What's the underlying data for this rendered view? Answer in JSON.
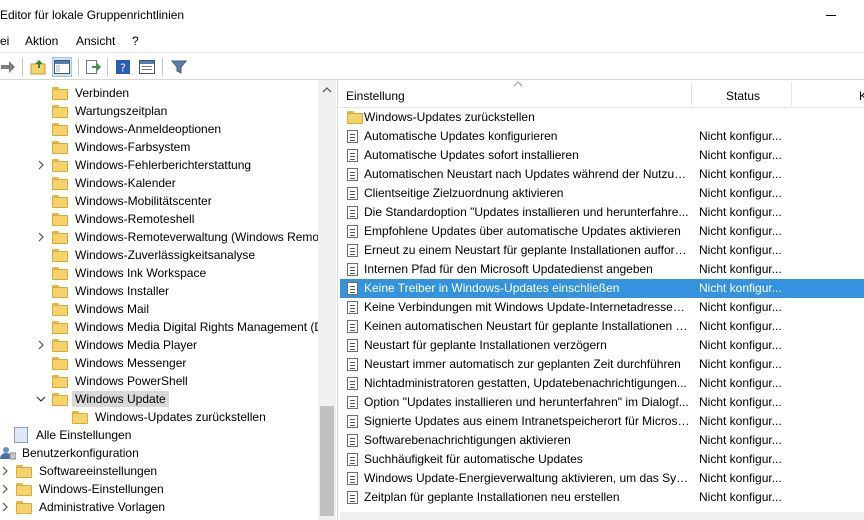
{
  "window": {
    "title": "Editor für lokale Gruppenrichtlinien"
  },
  "menu": [
    "ei",
    "Aktion",
    "Ansicht",
    "?"
  ],
  "tree": [
    {
      "label": "Verbinden",
      "indent": 2,
      "expandable": false
    },
    {
      "label": "Wartungszeitplan",
      "indent": 2,
      "expandable": false
    },
    {
      "label": "Windows-Anmeldeoptionen",
      "indent": 2,
      "expandable": false
    },
    {
      "label": "Windows-Farbsystem",
      "indent": 2,
      "expandable": false
    },
    {
      "label": "Windows-Fehlerberichterstattung",
      "indent": 2,
      "expandable": true
    },
    {
      "label": "Windows-Kalender",
      "indent": 2,
      "expandable": false
    },
    {
      "label": "Windows-Mobilitätscenter",
      "indent": 2,
      "expandable": false
    },
    {
      "label": "Windows-Remoteshell",
      "indent": 2,
      "expandable": false
    },
    {
      "label": "Windows-Remoteverwaltung (Windows Remo",
      "indent": 2,
      "expandable": true
    },
    {
      "label": "Windows-Zuverlässigkeitsanalyse",
      "indent": 2,
      "expandable": false
    },
    {
      "label": "Windows Ink Workspace",
      "indent": 2,
      "expandable": false
    },
    {
      "label": "Windows Installer",
      "indent": 2,
      "expandable": false
    },
    {
      "label": "Windows Mail",
      "indent": 2,
      "expandable": false
    },
    {
      "label": "Windows Media Digital Rights Management (D",
      "indent": 2,
      "expandable": false
    },
    {
      "label": "Windows Media Player",
      "indent": 2,
      "expandable": true
    },
    {
      "label": "Windows Messenger",
      "indent": 2,
      "expandable": false
    },
    {
      "label": "Windows PowerShell",
      "indent": 2,
      "expandable": false
    },
    {
      "label": "Windows Update",
      "indent": 2,
      "expandable": "open",
      "selected": true
    },
    {
      "label": "Windows-Updates zurückstellen",
      "indent": 3,
      "expandable": false
    },
    {
      "label": "Alle Einstellungen",
      "indent": 1,
      "expandable": false,
      "icon": "all-settings"
    },
    {
      "label": "Benutzerkonfiguration",
      "indent": 0,
      "expandable": false,
      "icon": "user"
    },
    {
      "label": "Softwareeinstellungen",
      "indent": 0.5,
      "expandable": true
    },
    {
      "label": "Windows-Einstellungen",
      "indent": 0.5,
      "expandable": true
    },
    {
      "label": "Administrative Vorlagen",
      "indent": 0.5,
      "expandable": true
    }
  ],
  "list": {
    "headers": {
      "setting": "Einstellung",
      "status": "Status",
      "comment": "K"
    },
    "rows": [
      {
        "name": "Windows-Updates zurückstellen",
        "status": "",
        "type": "folder"
      },
      {
        "name": "Automatische Updates konfigurieren",
        "status": "Nicht konfigur...",
        "type": "setting"
      },
      {
        "name": "Automatische Updates sofort installieren",
        "status": "Nicht konfigur...",
        "type": "setting"
      },
      {
        "name": "Automatischen Neustart nach Updates während der Nutzun...",
        "status": "Nicht konfigur...",
        "type": "setting"
      },
      {
        "name": "Clientseitige Zielzuordnung aktivieren",
        "status": "Nicht konfigur...",
        "type": "setting"
      },
      {
        "name": "Die Standardoption \"Updates installieren und herunterfahre...",
        "status": "Nicht konfigur...",
        "type": "setting"
      },
      {
        "name": "Empfohlene Updates über automatische Updates aktivieren",
        "status": "Nicht konfigur...",
        "type": "setting"
      },
      {
        "name": "Erneut zu einem Neustart für geplante Installationen aufford...",
        "status": "Nicht konfigur...",
        "type": "setting"
      },
      {
        "name": "Internen Pfad für den Microsoft Updatedienst angeben",
        "status": "Nicht konfigur...",
        "type": "setting"
      },
      {
        "name": "Keine Treiber in Windows-Updates einschließen",
        "status": "Nicht konfigur...",
        "type": "setting",
        "selected": true
      },
      {
        "name": "Keine Verbindungen mit Windows Update-Internetadressen ...",
        "status": "Nicht konfigur...",
        "type": "setting"
      },
      {
        "name": "Keinen automatischen Neustart für geplante Installationen a...",
        "status": "Nicht konfigur...",
        "type": "setting"
      },
      {
        "name": "Neustart für geplante Installationen verzögern",
        "status": "Nicht konfigur...",
        "type": "setting"
      },
      {
        "name": "Neustart immer automatisch zur geplanten Zeit durchführen",
        "status": "Nicht konfigur...",
        "type": "setting"
      },
      {
        "name": "Nichtadministratoren gestatten, Updatebenachrichtigungen...",
        "status": "Nicht konfigur...",
        "type": "setting"
      },
      {
        "name": "Option \"Updates installieren und herunterfahren\" im Dialogf...",
        "status": "Nicht konfigur...",
        "type": "setting"
      },
      {
        "name": "Signierte Updates aus einem Intranetspeicherort für Microso...",
        "status": "Nicht konfigur...",
        "type": "setting"
      },
      {
        "name": "Softwarebenachrichtigungen aktivieren",
        "status": "Nicht konfigur...",
        "type": "setting"
      },
      {
        "name": "Suchhäufigkeit für automatische Updates",
        "status": "Nicht konfigur...",
        "type": "setting"
      },
      {
        "name": "Windows Update-Energieverwaltung aktivieren, um das Syst...",
        "status": "Nicht konfigur...",
        "type": "setting"
      },
      {
        "name": "Zeitplan für geplante Installationen neu erstellen",
        "status": "Nicht konfigur...",
        "type": "setting"
      }
    ]
  },
  "colors": {
    "selection": "#3393df",
    "tree_selection": "#d9d9d9",
    "folder": "#f6d26b"
  }
}
